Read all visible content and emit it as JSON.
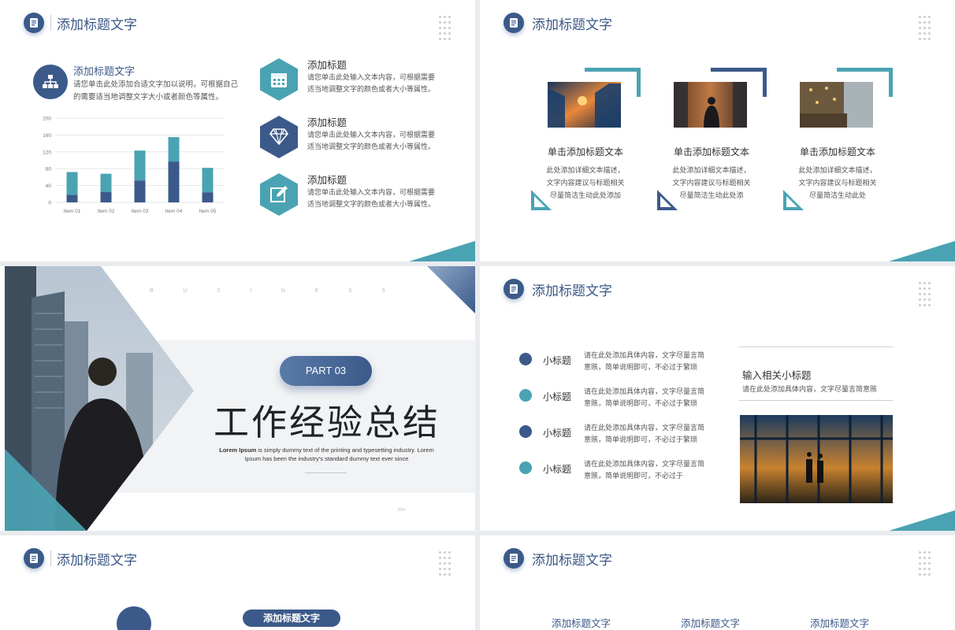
{
  "colors": {
    "navy": "#3b5a8a",
    "teal": "#4aa3b2",
    "title_blue": "#3a5786"
  },
  "s1": {
    "header": "添加标题文字",
    "subtitle": "添加标题文字",
    "desc": "请您单击此处添加合适文字加以说明，可根据自己的需要适当地调整文字大小或者颜色等属性。",
    "items": [
      {
        "title": "添加标题",
        "desc": "请您单击此处输入文本内容，可根据需要适当地调整文字的颜色或者大小等属性。",
        "icon": "calendar-icon"
      },
      {
        "title": "添加标题",
        "desc": "请您单击此处输入文本内容，可根据需要适当地调整文字的颜色或者大小等属性。",
        "icon": "diamond-icon"
      },
      {
        "title": "添加标题",
        "desc": "请您单击此处输入文本内容，可根据需要适当地调整文字的颜色或者大小等属性。",
        "icon": "edit-icon"
      }
    ]
  },
  "chart_data": {
    "type": "bar",
    "stacked": true,
    "categories": [
      "Item 01",
      "Item 02",
      "Item 03",
      "Item 04",
      "Item 05"
    ],
    "series": [
      {
        "values": [
          18,
          25,
          52,
          97,
          24
        ],
        "color": "#3b5a8a"
      },
      {
        "values": [
          54,
          43,
          71,
          58,
          58
        ],
        "color": "#4aa3b2"
      }
    ],
    "ylim": [
      0,
      200
    ],
    "yticks": [
      0,
      40,
      80,
      120,
      160,
      200
    ],
    "grid": true
  },
  "s2": {
    "header": "添加标题文字",
    "cards": [
      {
        "title": "单击添加标题文本",
        "desc": [
          "此处添加详细文本描述，",
          "文字内容建议与标题相关",
          "尽量简洁生动此处添加"
        ],
        "tri": "#4aa3b2"
      },
      {
        "title": "单击添加标题文本",
        "desc": [
          "此处添加详细文本描述，",
          "文字内容建议与标题相关",
          "尽量简洁生动此处添"
        ],
        "tri": "#3b5a8a"
      },
      {
        "title": "单击添加标题文本",
        "desc": [
          "此处添加详细文本描述，",
          "文字内容建议与标题相关",
          "尽量简洁生动此处"
        ],
        "tri": "#4aa3b2"
      }
    ]
  },
  "s3": {
    "letters": [
      "B",
      "U",
      "S",
      "I",
      "N",
      "E",
      "S",
      "S"
    ],
    "pill": "PART 03",
    "title": "工作经验总结",
    "body_bold": "Lorem Ipsum",
    "body": " is simply dummy text of the printing and typesetting industry. Lorem Ipsum has been the industry's standard dummy text ever since",
    "arrows": "››››››"
  },
  "s4": {
    "header": "添加标题文字",
    "items": [
      {
        "title": "小标题",
        "desc": "请在此处添加具体内容，文字尽量言简意赅，简单说明即可，不必过于繁琐",
        "color": "#3b5a8a"
      },
      {
        "title": "小标题",
        "desc": "请在此处添加具体内容，文字尽量言简意赅，简单说明即可，不必过于繁琐",
        "color": "#4aa3b2"
      },
      {
        "title": "小标题",
        "desc": "请在此处添加具体内容，文字尽量言简意赅，简单说明即可，不必过于繁琐",
        "color": "#3b5a8a"
      },
      {
        "title": "小标题",
        "desc": "请在此处添加具体内容，文字尽量言简意赅，简单说明即可，不必过于",
        "color": "#4aa3b2"
      }
    ],
    "sub": "输入相关小标题",
    "sub_desc": "请在此处添加具体内容，文字尽量言简意赅"
  },
  "s5": {
    "header": "添加标题文字",
    "pill": "添加标题文字"
  },
  "s6": {
    "header": "添加标题文字",
    "headings": [
      "添加标题文字",
      "添加标题文字",
      "添加标题文字"
    ]
  }
}
